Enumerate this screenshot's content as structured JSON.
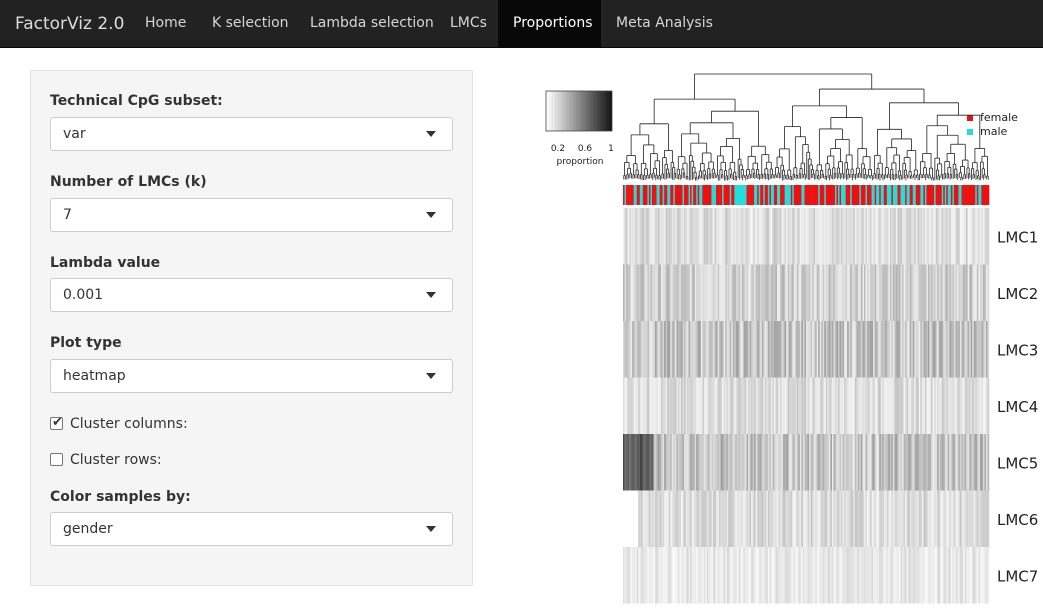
{
  "navbar": {
    "brand": "FactorViz 2.0",
    "items": [
      {
        "label": "Home"
      },
      {
        "label": "K selection"
      },
      {
        "label": "Lambda selection"
      },
      {
        "label": "LMCs"
      },
      {
        "label": "Proportions",
        "active": true
      },
      {
        "label": "Meta Analysis"
      }
    ]
  },
  "sidebar": {
    "cpg_subset": {
      "label": "Technical CpG subset:",
      "value": "var"
    },
    "k": {
      "label": "Number of LMCs (k)",
      "value": "7"
    },
    "lambda": {
      "label": "Lambda value",
      "value": "0.001"
    },
    "plot_type": {
      "label": "Plot type",
      "value": "heatmap"
    },
    "cluster_columns": {
      "label": "Cluster columns:",
      "checked": true
    },
    "cluster_rows": {
      "label": "Cluster rows:",
      "checked": false
    },
    "color_by": {
      "label": "Color samples by:",
      "value": "gender"
    }
  },
  "chart_data": {
    "type": "heatmap",
    "rows": [
      "LMC1",
      "LMC2",
      "LMC3",
      "LMC4",
      "LMC5",
      "LMC6",
      "LMC7"
    ],
    "row_mean_proportion": [
      0.15,
      0.2,
      0.25,
      0.15,
      0.25,
      0.15,
      0.1
    ],
    "color_scale": {
      "ticks": [
        "0.2",
        "0.6",
        "1"
      ],
      "label": "proportion"
    },
    "legend": [
      {
        "name": "female",
        "color": "#ee1111"
      },
      {
        "name": "male",
        "color": "#22dddd"
      }
    ],
    "dendrogram": "columns",
    "annotation": "gender"
  }
}
